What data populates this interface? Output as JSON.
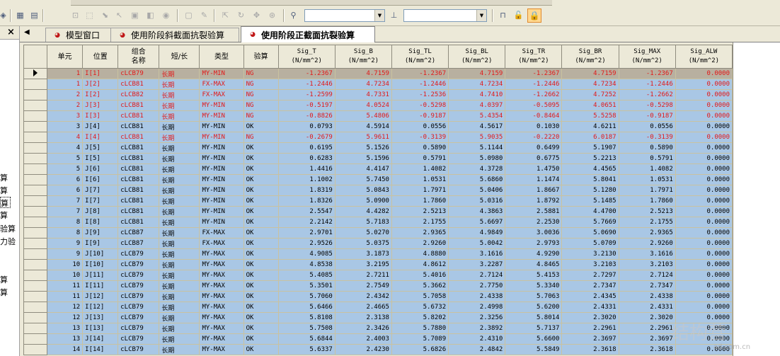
{
  "toolbar": {
    "icons": [
      "wand-icon",
      "tree-icon",
      "tree-alt-icon",
      "fit-icon",
      "zoom-window-icon",
      "select-icon",
      "pointer-icon",
      "box3d-icon",
      "shade-icon",
      "node-icon",
      "view-icon",
      "tool-icon",
      "move-icon",
      "rotate-icon",
      "pan-icon",
      "orbit-icon",
      "pin-icon",
      "combo-a-arrow",
      "combo-b-arrow",
      "ruler-icon",
      "lock-icon",
      "lock-active-icon"
    ],
    "combo_a_value": "",
    "combo_b_value": ""
  },
  "sidebar": {
    "items": [
      {
        "label": "算"
      },
      {
        "label": "算"
      },
      {
        "label": "算"
      },
      {
        "label": "算"
      },
      {
        "label": "验算"
      },
      {
        "label": "力验"
      },
      {
        "label": "算"
      },
      {
        "label": "算"
      }
    ]
  },
  "tabs": [
    {
      "label": "模型窗口",
      "active": false
    },
    {
      "label": "使用阶段斜截面抗裂验算",
      "active": false
    },
    {
      "label": "使用阶段正截面抗裂验算",
      "active": true
    }
  ],
  "table": {
    "headers": [
      "单元",
      "位置",
      "组合\n名称",
      "短/长",
      "类型",
      "验算",
      "Sig_T\n(N/mm^2)",
      "Sig_B\n(N/mm^2)",
      "Sig_TL\n(N/mm^2)",
      "Sig_BL\n(N/mm^2)",
      "Sig_TR\n(N/mm^2)",
      "Sig_BR\n(N/mm^2)",
      "Sig_MAX\n(N/mm^2)",
      "Sig_ALW\n(N/mm^2)"
    ],
    "rows": [
      {
        "status": "cur",
        "cells": [
          "1",
          "I[1]",
          "cLCB79",
          "长期",
          "MY-MIN",
          "NG",
          "-1.2367",
          "4.7159",
          "-1.2367",
          "4.7159",
          "-1.2367",
          "4.7159",
          "-1.2367",
          "0.0000"
        ]
      },
      {
        "status": "ng",
        "cells": [
          "1",
          "J[2]",
          "cLCB81",
          "长期",
          "FX-MAX",
          "NG",
          "-1.2446",
          "4.7234",
          "-1.2446",
          "4.7234",
          "-1.2446",
          "4.7234",
          "-1.2446",
          "0.0000"
        ]
      },
      {
        "status": "ng",
        "cells": [
          "2",
          "I[2]",
          "cLCB82",
          "长期",
          "FX-MAX",
          "NG",
          "-1.2599",
          "4.7331",
          "-1.2536",
          "4.7410",
          "-1.2662",
          "4.7252",
          "-1.2662",
          "0.0000"
        ]
      },
      {
        "status": "ng",
        "cells": [
          "2",
          "J[3]",
          "cLCB81",
          "长期",
          "MY-MIN",
          "NG",
          "-0.5197",
          "4.0524",
          "-0.5298",
          "4.0397",
          "-0.5095",
          "4.0651",
          "-0.5298",
          "0.0000"
        ]
      },
      {
        "status": "ng",
        "cells": [
          "3",
          "I[3]",
          "cLCB81",
          "长期",
          "MY-MIN",
          "NG",
          "-0.8826",
          "5.4806",
          "-0.9187",
          "5.4354",
          "-0.8464",
          "5.5258",
          "-0.9187",
          "0.0000"
        ]
      },
      {
        "status": "ok",
        "cells": [
          "3",
          "J[4]",
          "cLCB81",
          "长期",
          "MY-MIN",
          "OK",
          "0.0793",
          "4.5914",
          "0.0556",
          "4.5617",
          "0.1030",
          "4.6211",
          "0.0556",
          "0.0000"
        ]
      },
      {
        "status": "ng",
        "cells": [
          "4",
          "I[4]",
          "cLCB81",
          "长期",
          "MY-MIN",
          "NG",
          "-0.2679",
          "5.9611",
          "-0.3139",
          "5.9035",
          "-0.2220",
          "6.0187",
          "-0.3139",
          "0.0000"
        ]
      },
      {
        "status": "ok",
        "cells": [
          "4",
          "J[5]",
          "cLCB81",
          "长期",
          "MY-MIN",
          "OK",
          "0.6195",
          "5.1526",
          "0.5890",
          "5.1144",
          "0.6499",
          "5.1907",
          "0.5890",
          "0.0000"
        ]
      },
      {
        "status": "ok",
        "cells": [
          "5",
          "I[5]",
          "cLCB81",
          "长期",
          "MY-MIN",
          "OK",
          "0.6283",
          "5.1596",
          "0.5791",
          "5.0980",
          "0.6775",
          "5.2213",
          "0.5791",
          "0.0000"
        ]
      },
      {
        "status": "ok",
        "cells": [
          "5",
          "J[6]",
          "cLCB81",
          "长期",
          "MY-MIN",
          "OK",
          "1.4416",
          "4.4147",
          "1.4082",
          "4.3728",
          "1.4750",
          "4.4565",
          "1.4082",
          "0.0000"
        ]
      },
      {
        "status": "ok",
        "cells": [
          "6",
          "I[6]",
          "cLCB81",
          "长期",
          "MY-MIN",
          "OK",
          "1.1002",
          "5.7450",
          "1.0531",
          "5.6860",
          "1.1474",
          "5.8041",
          "1.0531",
          "0.0000"
        ]
      },
      {
        "status": "ok",
        "cells": [
          "6",
          "J[7]",
          "cLCB81",
          "长期",
          "MY-MIN",
          "OK",
          "1.8319",
          "5.0843",
          "1.7971",
          "5.0406",
          "1.8667",
          "5.1280",
          "1.7971",
          "0.0000"
        ]
      },
      {
        "status": "ok",
        "cells": [
          "7",
          "I[7]",
          "cLCB81",
          "长期",
          "MY-MIN",
          "OK",
          "1.8326",
          "5.0900",
          "1.7860",
          "5.0316",
          "1.8792",
          "5.1485",
          "1.7860",
          "0.0000"
        ]
      },
      {
        "status": "ok",
        "cells": [
          "7",
          "J[8]",
          "cLCB81",
          "长期",
          "MY-MIN",
          "OK",
          "2.5547",
          "4.4282",
          "2.5213",
          "4.3863",
          "2.5881",
          "4.4700",
          "2.5213",
          "0.0000"
        ]
      },
      {
        "status": "ok",
        "cells": [
          "8",
          "I[8]",
          "cLCB81",
          "长期",
          "MY-MIN",
          "OK",
          "2.2142",
          "5.7183",
          "2.1755",
          "5.6697",
          "2.2530",
          "5.7669",
          "2.1755",
          "0.0000"
        ]
      },
      {
        "status": "ok",
        "cells": [
          "8",
          "J[9]",
          "cLCB87",
          "长期",
          "FX-MAX",
          "OK",
          "2.9701",
          "5.0270",
          "2.9365",
          "4.9849",
          "3.0036",
          "5.0690",
          "2.9365",
          "0.0000"
        ]
      },
      {
        "status": "ok",
        "cells": [
          "9",
          "I[9]",
          "cLCB87",
          "长期",
          "FX-MAX",
          "OK",
          "2.9526",
          "5.0375",
          "2.9260",
          "5.0042",
          "2.9793",
          "5.0709",
          "2.9260",
          "0.0000"
        ]
      },
      {
        "status": "ok",
        "cells": [
          "9",
          "J[10]",
          "cLCB79",
          "长期",
          "MY-MAX",
          "OK",
          "4.9085",
          "3.1873",
          "4.8880",
          "3.1616",
          "4.9290",
          "3.2130",
          "3.1616",
          "0.0000"
        ]
      },
      {
        "status": "ok",
        "cells": [
          "10",
          "I[10]",
          "cLCB79",
          "长期",
          "MY-MAX",
          "OK",
          "4.8538",
          "3.2195",
          "4.8612",
          "3.2287",
          "4.8465",
          "3.2103",
          "3.2103",
          "0.0000"
        ]
      },
      {
        "status": "ok",
        "cells": [
          "10",
          "J[11]",
          "cLCB79",
          "长期",
          "MY-MAX",
          "OK",
          "5.4085",
          "2.7211",
          "5.4016",
          "2.7124",
          "5.4153",
          "2.7297",
          "2.7124",
          "0.0000"
        ]
      },
      {
        "status": "ok",
        "cells": [
          "11",
          "I[11]",
          "cLCB79",
          "长期",
          "MY-MAX",
          "OK",
          "5.3501",
          "2.7549",
          "5.3662",
          "2.7750",
          "5.3340",
          "2.7347",
          "2.7347",
          "0.0000"
        ]
      },
      {
        "status": "ok",
        "cells": [
          "11",
          "J[12]",
          "cLCB79",
          "长期",
          "MY-MAX",
          "OK",
          "5.7060",
          "2.4342",
          "5.7058",
          "2.4338",
          "5.7063",
          "2.4345",
          "2.4338",
          "0.0000"
        ]
      },
      {
        "status": "ok",
        "cells": [
          "12",
          "I[12]",
          "cLCB79",
          "长期",
          "MY-MAX",
          "OK",
          "5.6466",
          "2.4665",
          "5.6732",
          "2.4998",
          "5.6200",
          "2.4331",
          "2.4331",
          "0.0000"
        ]
      },
      {
        "status": "ok",
        "cells": [
          "12",
          "J[13]",
          "cLCB79",
          "长期",
          "MY-MAX",
          "OK",
          "5.8108",
          "2.3138",
          "5.8202",
          "2.3256",
          "5.8014",
          "2.3020",
          "2.3020",
          "0.0000"
        ]
      },
      {
        "status": "ok",
        "cells": [
          "13",
          "I[13]",
          "cLCB79",
          "长期",
          "MY-MAX",
          "OK",
          "5.7508",
          "2.3426",
          "5.7880",
          "2.3892",
          "5.7137",
          "2.2961",
          "2.2961",
          "0.0000"
        ]
      },
      {
        "status": "ok",
        "cells": [
          "13",
          "J[14]",
          "cLCB79",
          "长期",
          "MY-MAX",
          "OK",
          "5.6844",
          "2.4003",
          "5.7089",
          "2.4310",
          "5.6600",
          "2.3697",
          "2.3697",
          "0.0000"
        ]
      },
      {
        "status": "ok",
        "cells": [
          "14",
          "I[14]",
          "cLCB79",
          "长期",
          "MY-MAX",
          "OK",
          "5.6337",
          "2.4230",
          "5.6826",
          "2.4842",
          "5.5849",
          "2.3618",
          "2.3618",
          "0.0000"
        ]
      }
    ]
  },
  "watermark": {
    "text": "结构营",
    "sub": "ad.com.cn"
  },
  "colors": {
    "ok_row": "#a9c7e5",
    "ng_text": "#e21818",
    "current_row": "#b8b0a0"
  }
}
